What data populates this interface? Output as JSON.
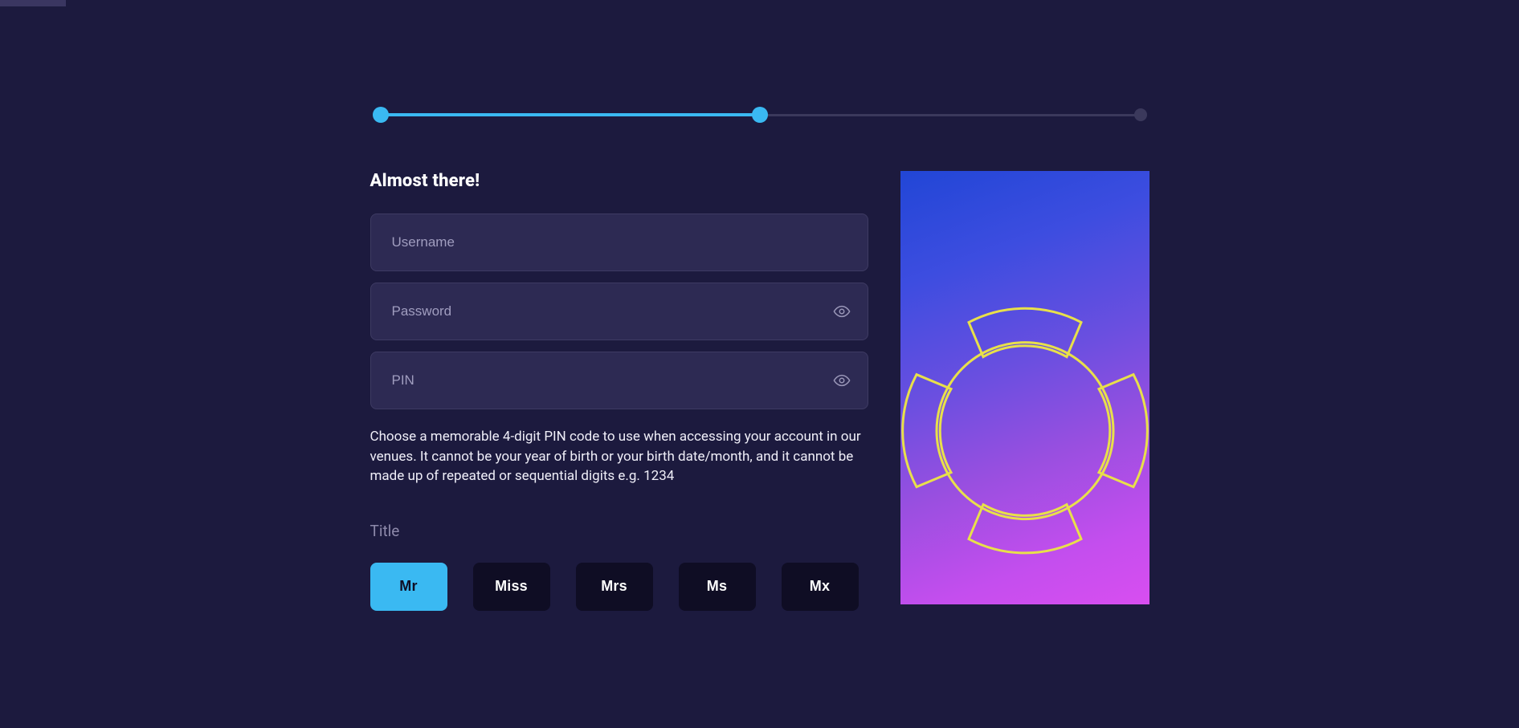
{
  "progress": {
    "steps": 3,
    "current": 2
  },
  "heading": "Almost there!",
  "fields": {
    "username": {
      "placeholder": "Username",
      "value": ""
    },
    "password": {
      "placeholder": "Password",
      "value": ""
    },
    "pin": {
      "placeholder": "PIN",
      "value": ""
    }
  },
  "help_text": "Choose a memorable 4-digit PIN code to use when accessing your account in our venues. It cannot be your year of birth or your birth date/month, and it cannot be made up of repeated or sequential digits e.g. 1234",
  "title": {
    "label": "Title",
    "options": [
      "Mr",
      "Miss",
      "Mrs",
      "Ms",
      "Mx"
    ],
    "selected": "Mr"
  },
  "icons": {
    "eye": "eye-icon"
  },
  "colors": {
    "accent": "#3ab9f2",
    "bg": "#1c1a3e",
    "input_bg": "#2d2a53",
    "dark_btn": "#0f0d24"
  }
}
